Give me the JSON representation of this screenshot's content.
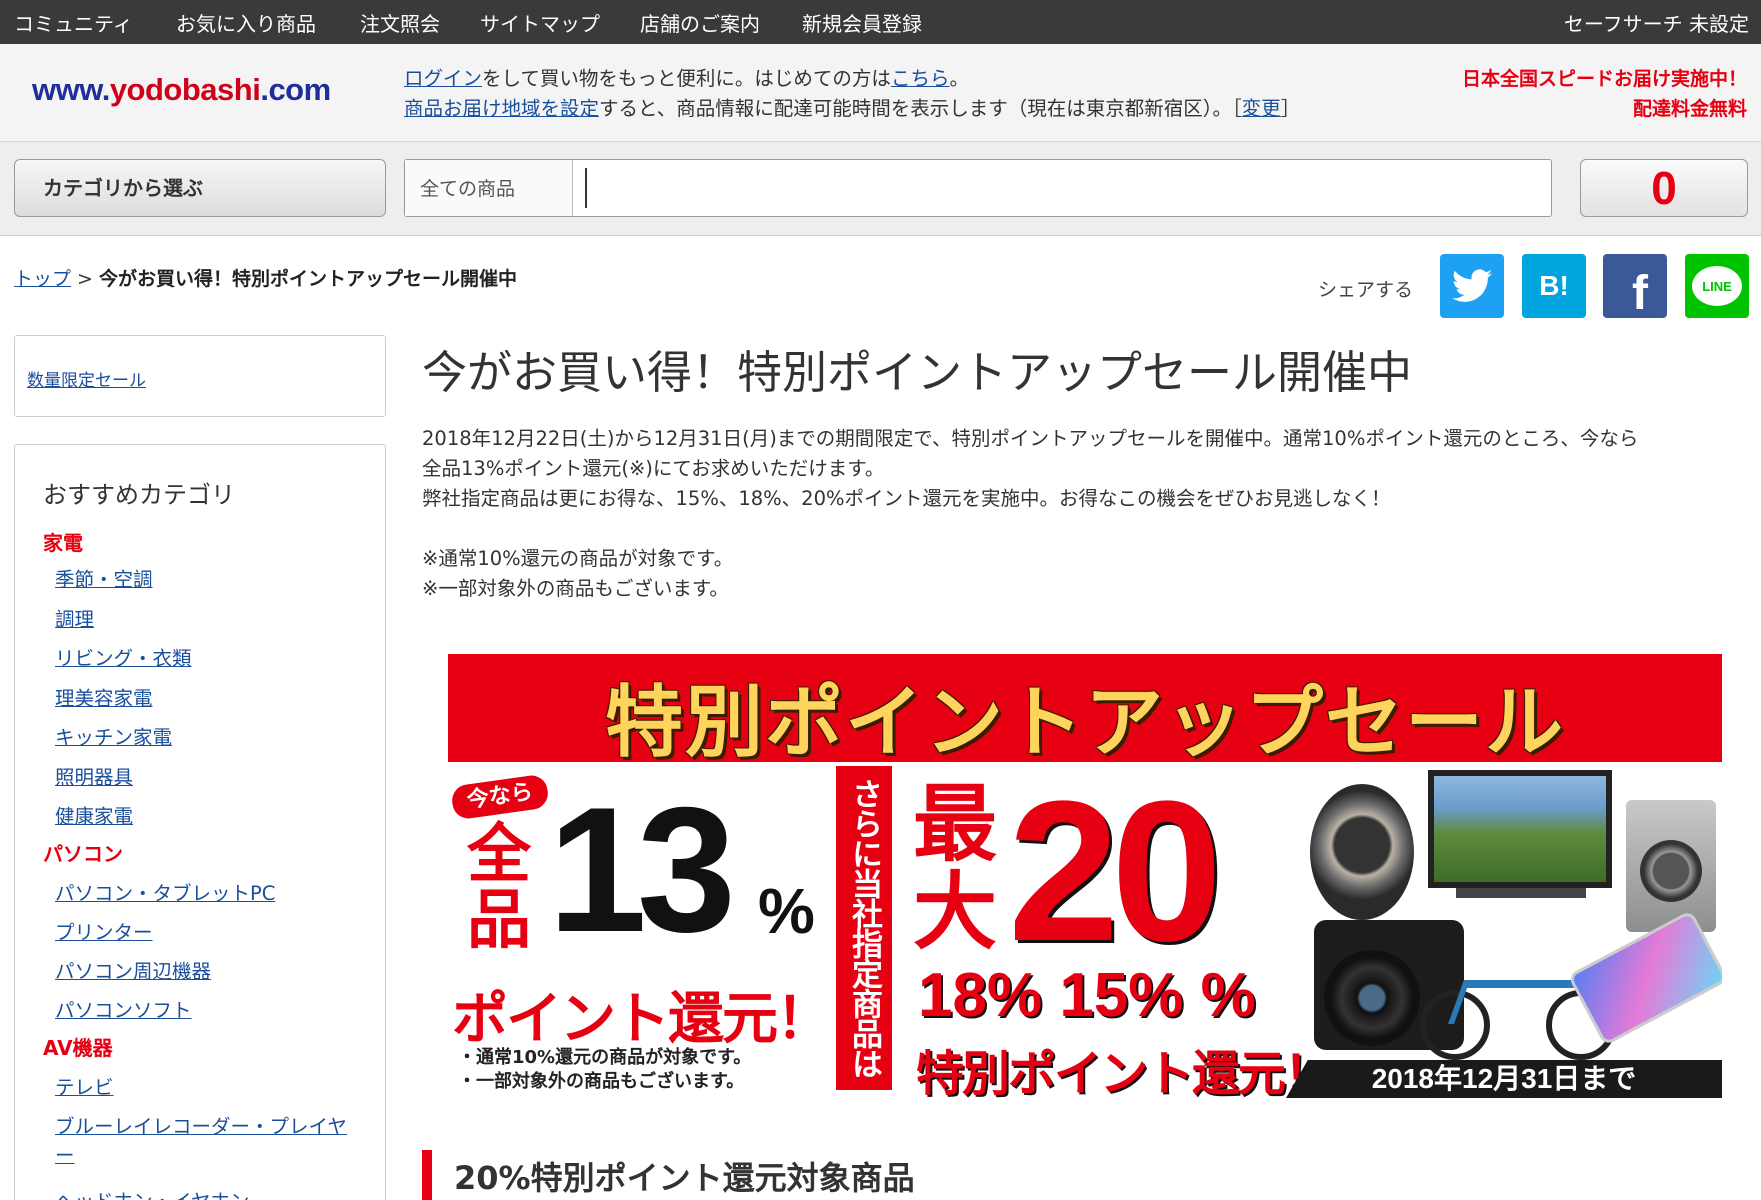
{
  "topnav": {
    "items": [
      "コミュニティ",
      "お気に入り商品",
      "注文照会",
      "サイトマップ",
      "店舗のご案内",
      "新規会員登録"
    ],
    "safe_search": "セーフサーチ 未設定"
  },
  "header": {
    "logo_www": "www.",
    "logo_mid": "yodobashi",
    "logo_end": ".com",
    "login_link": "ログイン",
    "login_text": "をして買い物をもっと便利に。はじめての方は",
    "here_link": "こちら",
    "period": "。",
    "delivery_link": "商品お届け地域を設定",
    "delivery_text": "すると、商品情報に配達可能時間を表示します（現在は東京都新宿区）。［",
    "change_link": "変更",
    "bracket_close": "］",
    "promo_line1": "日本全国スピードお届け実施中！",
    "promo_line2": "配達料金無料"
  },
  "searchbar": {
    "category_button": "カテゴリから選ぶ",
    "scope": "全ての商品",
    "query": "",
    "cart_count": "0"
  },
  "breadcrumb": {
    "top": "トップ",
    "separator": ">",
    "current": "今がお買い得！特別ポイントアップセール開催中"
  },
  "share": {
    "label": "シェアする",
    "hatena": "B!",
    "facebook": "f",
    "line": "LINE"
  },
  "sidebar": {
    "limited_sale": "数量限定セール",
    "title": "おすすめカテゴリ",
    "cat_appliances": "家電",
    "appliances": [
      "季節・空調",
      "調理",
      "リビング・衣類",
      "理美容家電",
      "キッチン家電",
      "照明器具",
      "健康家電"
    ],
    "cat_pc": "パソコン",
    "pc": [
      "パソコン・タブレットPC",
      "プリンター",
      "パソコン周辺機器",
      "パソコンソフト"
    ],
    "cat_av": "AV機器",
    "av_tv": "テレビ",
    "av_bd_1": "ブルーレイレコーダー・プレイヤ",
    "av_bd_2": "ー",
    "av_headphone": "ヘッドホン・イヤホン"
  },
  "main": {
    "title": "今がお買い得！特別ポイントアップセール開催中",
    "desc_line1": "2018年12月22日(土)から12月31日(月)までの期間限定で、特別ポイントアップセールを開催中。通常10%ポイント還元のところ、今なら",
    "desc_line2": "全品13%ポイント還元(※)にてお求めいただけます。",
    "desc_line3": "弊社指定商品は更にお得な、15%、18%、20%ポイント還元を実施中。お得なこの機会をぜひお見逃しなく！",
    "note1": "※通常10%還元の商品が対象です。",
    "note2": "※一部対象外の商品もございます。",
    "section_heading": "20%特別ポイント還元対象商品"
  },
  "banner": {
    "title": "特別ポイントアップセール",
    "ima_nara": "今なら",
    "zenpin": "全品",
    "pct13": "13",
    "pct_sign": "%",
    "kangen1": "ポイント還元！",
    "note1": "・通常10%還元の商品が対象です。",
    "note2": "・一部対象外の商品もございます。",
    "vertical": "さらに当社指定商品は",
    "saidai": "最大",
    "pct20": "20",
    "pct1815": "18% 15% %",
    "kangen2": "特別ポイント還元！",
    "date": "2018年12月31日まで"
  }
}
